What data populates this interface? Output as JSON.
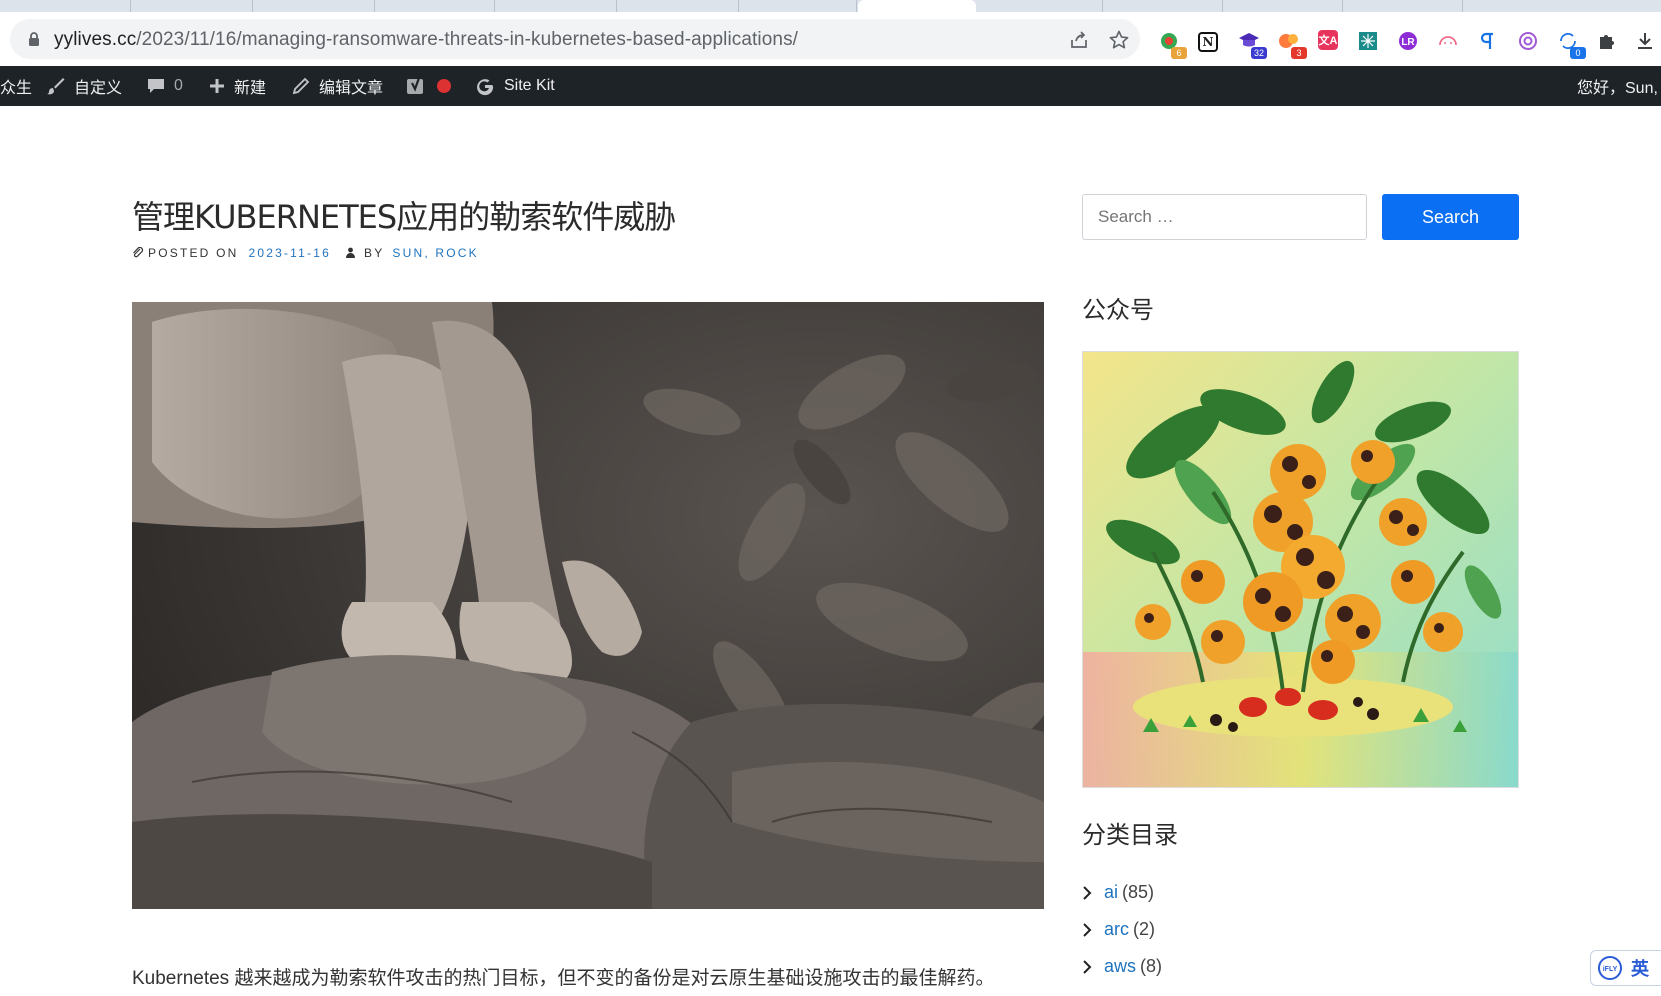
{
  "browser": {
    "url_host": "yylives.cc",
    "url_path": "/2023/11/16/managing-ransomware-threats-in-kubernetes-based-applications/",
    "extensions": [
      {
        "name": "extension-badge-6",
        "badge": "6",
        "badge_color": "#e8710a"
      },
      {
        "name": "notion-extension",
        "badge": ""
      },
      {
        "name": "extension-badge-32",
        "badge": "32",
        "badge_color": "#1a73e8"
      },
      {
        "name": "extension-badge-3",
        "badge": "3",
        "badge_color": "#d93025"
      },
      {
        "name": "translate-extension",
        "badge": ""
      },
      {
        "name": "grid-extension",
        "badge": ""
      },
      {
        "name": "purple-extension",
        "badge": ""
      },
      {
        "name": "cloud-extension",
        "badge": ""
      },
      {
        "name": "blue-extension",
        "badge": ""
      },
      {
        "name": "openai-extension",
        "badge": ""
      },
      {
        "name": "sync-extension",
        "badge": "0",
        "badge_color": "#1a73e8"
      },
      {
        "name": "puzzle-extension",
        "badge": ""
      },
      {
        "name": "download-extension",
        "badge": ""
      }
    ]
  },
  "adminbar": {
    "site_fragment": "众生",
    "customize": "自定义",
    "comments_count": "0",
    "new": "新建",
    "edit_post": "编辑文章",
    "sitekit": "Site Kit",
    "greeting": "您好，Sun,"
  },
  "post": {
    "title": "管理KUBERNETES应用的勒索软件威胁",
    "posted_on_label": "POSTED ON",
    "date": "2023-11-16",
    "by_label": "BY",
    "author": "SUN, ROCK",
    "excerpt": "Kubernetes 越来越成为勒索软件攻击的热门目标，但不变的备份是对云原生基础设施攻击的最佳解药。"
  },
  "sidebar": {
    "search_placeholder": "Search …",
    "search_button": "Search",
    "wechat_title": "公众号",
    "categories_title": "分类目录",
    "categories": [
      {
        "name": "ai",
        "count": "(85)"
      },
      {
        "name": "arc",
        "count": "(2)"
      },
      {
        "name": "aws",
        "count": "(8)"
      }
    ]
  },
  "ifly": {
    "lang": "英"
  }
}
